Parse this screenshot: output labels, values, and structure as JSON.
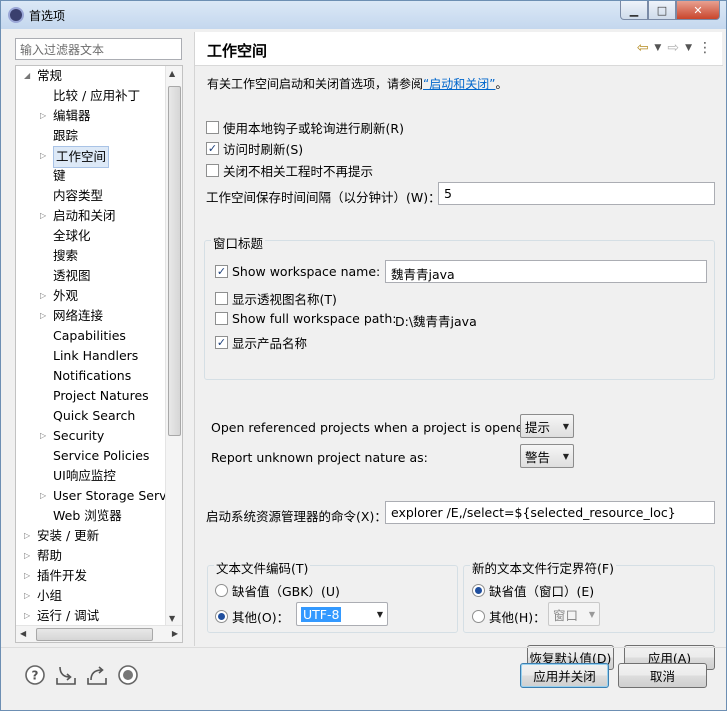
{
  "window": {
    "title": "首选项",
    "buttons": {
      "minimize": "▁",
      "maximize": "□",
      "close": "✕"
    }
  },
  "filter": {
    "placeholder": "输入过滤器文本"
  },
  "tree": {
    "items": [
      {
        "label": "常规",
        "level": 0,
        "arrow": "expanded"
      },
      {
        "label": "比较 / 应用补丁",
        "level": 1,
        "arrow": "none"
      },
      {
        "label": "编辑器",
        "level": 1,
        "arrow": "collapsed"
      },
      {
        "label": "跟踪",
        "level": 1,
        "arrow": "none"
      },
      {
        "label": "工作空间",
        "level": 1,
        "arrow": "collapsed",
        "selected": true
      },
      {
        "label": "键",
        "level": 1,
        "arrow": "none"
      },
      {
        "label": "内容类型",
        "level": 1,
        "arrow": "none"
      },
      {
        "label": "启动和关闭",
        "level": 1,
        "arrow": "collapsed"
      },
      {
        "label": "全球化",
        "level": 1,
        "arrow": "none"
      },
      {
        "label": "搜索",
        "level": 1,
        "arrow": "none"
      },
      {
        "label": "透视图",
        "level": 1,
        "arrow": "none"
      },
      {
        "label": "外观",
        "level": 1,
        "arrow": "collapsed"
      },
      {
        "label": "网络连接",
        "level": 1,
        "arrow": "collapsed"
      },
      {
        "label": "Capabilities",
        "level": 1,
        "arrow": "none"
      },
      {
        "label": "Link Handlers",
        "level": 1,
        "arrow": "none"
      },
      {
        "label": "Notifications",
        "level": 1,
        "arrow": "none"
      },
      {
        "label": "Project Natures",
        "level": 1,
        "arrow": "none"
      },
      {
        "label": "Quick Search",
        "level": 1,
        "arrow": "none"
      },
      {
        "label": "Security",
        "level": 1,
        "arrow": "collapsed"
      },
      {
        "label": "Service Policies",
        "level": 1,
        "arrow": "none"
      },
      {
        "label": "UI响应监控",
        "level": 1,
        "arrow": "none"
      },
      {
        "label": "User Storage Servic",
        "level": 1,
        "arrow": "collapsed"
      },
      {
        "label": "Web 浏览器",
        "level": 1,
        "arrow": "none"
      },
      {
        "label": "安装 / 更新",
        "level": 0,
        "arrow": "collapsed"
      },
      {
        "label": "帮助",
        "level": 0,
        "arrow": "collapsed"
      },
      {
        "label": "插件开发",
        "level": 0,
        "arrow": "collapsed"
      },
      {
        "label": "小组",
        "level": 0,
        "arrow": "collapsed"
      },
      {
        "label": "运行 / 调试",
        "level": 0,
        "arrow": "collapsed"
      }
    ]
  },
  "header": {
    "title": "工作空间",
    "nav": {
      "back": "⇦",
      "back_menu": "▼",
      "forward": "⇨",
      "forward_menu": "▼",
      "view_menu": "⋮"
    }
  },
  "intro": {
    "text": "有关工作空间启动和关闭首选项，请参阅",
    "link": "“启动和关闭”",
    "suffix": "。"
  },
  "options": {
    "refresh_hooks": {
      "label": "使用本地钩子或轮询进行刷新(R)",
      "checked": false
    },
    "refresh_on_access": {
      "label": "访问时刷新(S)",
      "checked": true
    },
    "close_unrelated": {
      "label": "关闭不相关工程时不再提示",
      "checked": false
    },
    "save_interval": {
      "label": "工作空间保存时间间隔（以分钟计）(W)：",
      "value": "5"
    }
  },
  "window_title_group": {
    "title": "窗口标题",
    "show_workspace_name": {
      "label": "Show workspace name:",
      "checked": true,
      "value": "魏青青java"
    },
    "show_perspective": {
      "label": "显示透视图名称(T)",
      "checked": false
    },
    "show_full_path": {
      "label": "Show full workspace path:",
      "checked": false,
      "value": "D:\\魏青青java"
    },
    "show_product": {
      "label": "显示产品名称",
      "checked": true
    }
  },
  "referenced": {
    "label": "Open referenced projects when a project is opened:",
    "value": "提示"
  },
  "unknown_nature": {
    "label": "Report unknown project nature as:",
    "value": "警告"
  },
  "explorer_cmd": {
    "label": "启动系统资源管理器的命令(X)：",
    "value": "explorer /E,/select=${selected_resource_loc}"
  },
  "encoding": {
    "title": "文本文件编码(T)",
    "default": {
      "label": "缺省值（GBK）(U)",
      "selected": false
    },
    "other": {
      "label": "其他(O)：",
      "selected": true,
      "value": "UTF-8"
    }
  },
  "line_delimiter": {
    "title": "新的文本文件行定界符(F)",
    "default": {
      "label": "缺省值（窗口）(E)",
      "selected": true
    },
    "other": {
      "label": "其他(H)：",
      "selected": false,
      "value": "窗口"
    }
  },
  "buttons": {
    "restore_defaults": "恢复默认值(D)",
    "apply": "应用(A)",
    "apply_and_close": "应用并关闭",
    "cancel": "取消"
  },
  "bottom_icons": [
    "help-icon",
    "import-icon",
    "export-icon",
    "record-icon"
  ]
}
